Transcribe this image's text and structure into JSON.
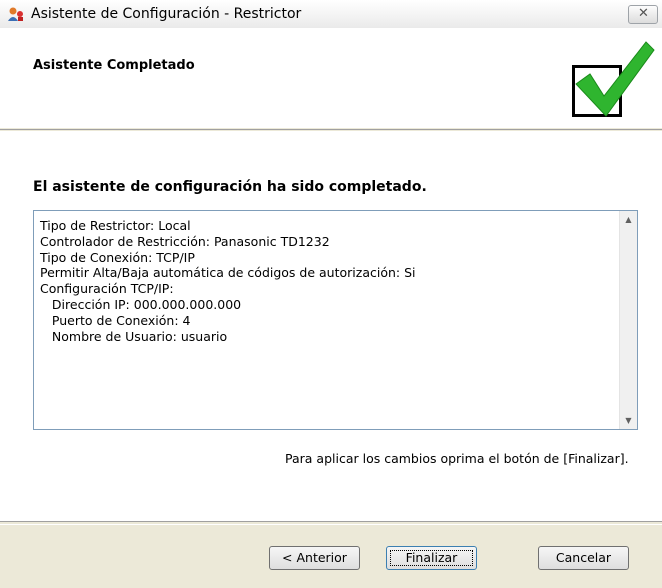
{
  "window": {
    "title": "Asistente de Configuración - Restrictor",
    "close_glyph": "✕"
  },
  "header": {
    "title": "Asistente Completado",
    "icon": "checkmark-icon"
  },
  "content": {
    "heading": "El asistente de configuración ha sido completado.",
    "summary_lines": [
      "Tipo de Restrictor: Local",
      "Controlador de Restricción: Panasonic TD1232",
      "Tipo de Conexión: TCP/IP",
      "Permitir Alta/Baja automática de códigos de autorización: Si",
      "Configuración TCP/IP:",
      "   Dirección IP: 000.000.000.000",
      "   Puerto de Conexión: 4",
      "   Nombre de Usuario: usuario"
    ],
    "apply_note": "Para aplicar los cambios oprima el botón de [Finalizar]."
  },
  "buttons": {
    "back_label": "< Anterior",
    "finish_label": "Finalizar",
    "cancel_label": "Cancelar"
  },
  "colors": {
    "check": "#2fb52f",
    "accent": "#3c7fb1"
  }
}
